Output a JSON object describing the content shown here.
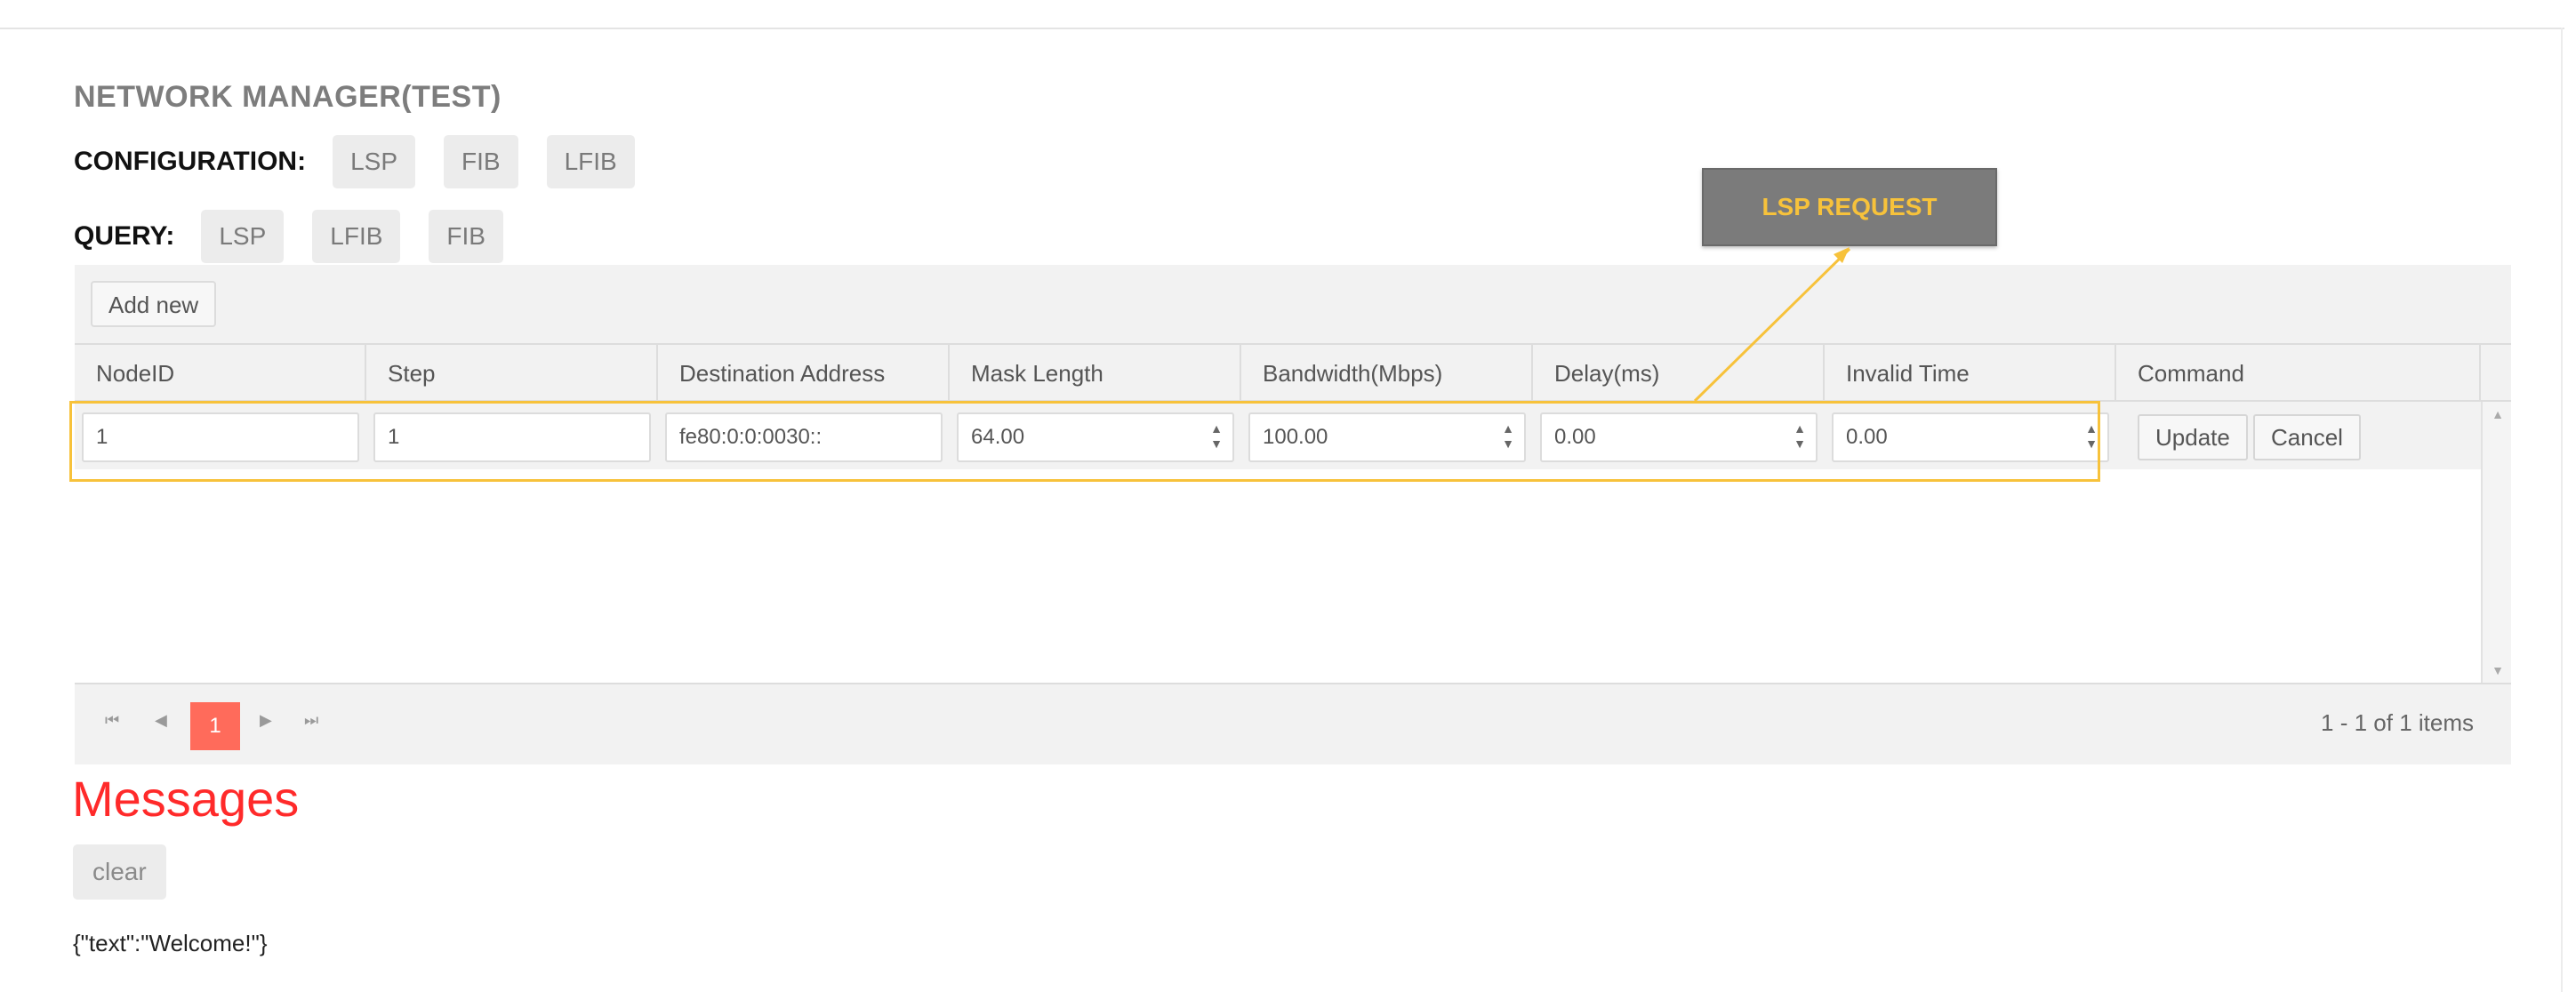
{
  "app": {
    "title": "NETWORK MANAGER(TEST)"
  },
  "configuration": {
    "label": "CONFIGURATION:",
    "buttons": [
      "LSP",
      "FIB",
      "LFIB"
    ]
  },
  "query": {
    "label": "QUERY:",
    "buttons": [
      "LSP",
      "LFIB",
      "FIB"
    ]
  },
  "grid": {
    "add_new_label": "Add new",
    "columns": [
      "NodeID",
      "Step",
      "Destination Address",
      "Mask Length",
      "Bandwidth(Mbps)",
      "Delay(ms)",
      "Invalid Time",
      "Command"
    ],
    "edit_row": {
      "node_id": "1",
      "step": "1",
      "destination_address": "fe80:0:0:0030::",
      "mask_length": "64.00",
      "bandwidth": "100.00",
      "delay": "0.00",
      "invalid_time": "0.00"
    },
    "commands": {
      "update": "Update",
      "cancel": "Cancel"
    },
    "pager": {
      "current_page": "1",
      "info": "1 - 1 of 1 items"
    }
  },
  "callout": {
    "label": "LSP REQUEST",
    "color": "#f7c23b"
  },
  "messages": {
    "title": "Messages",
    "clear_label": "clear",
    "log": "{\"text\":\"Welcome!\"}",
    "title_color": "#ff2a2a"
  },
  "colors": {
    "pager_active": "#ff6b5b",
    "highlight": "#f7c23b"
  }
}
